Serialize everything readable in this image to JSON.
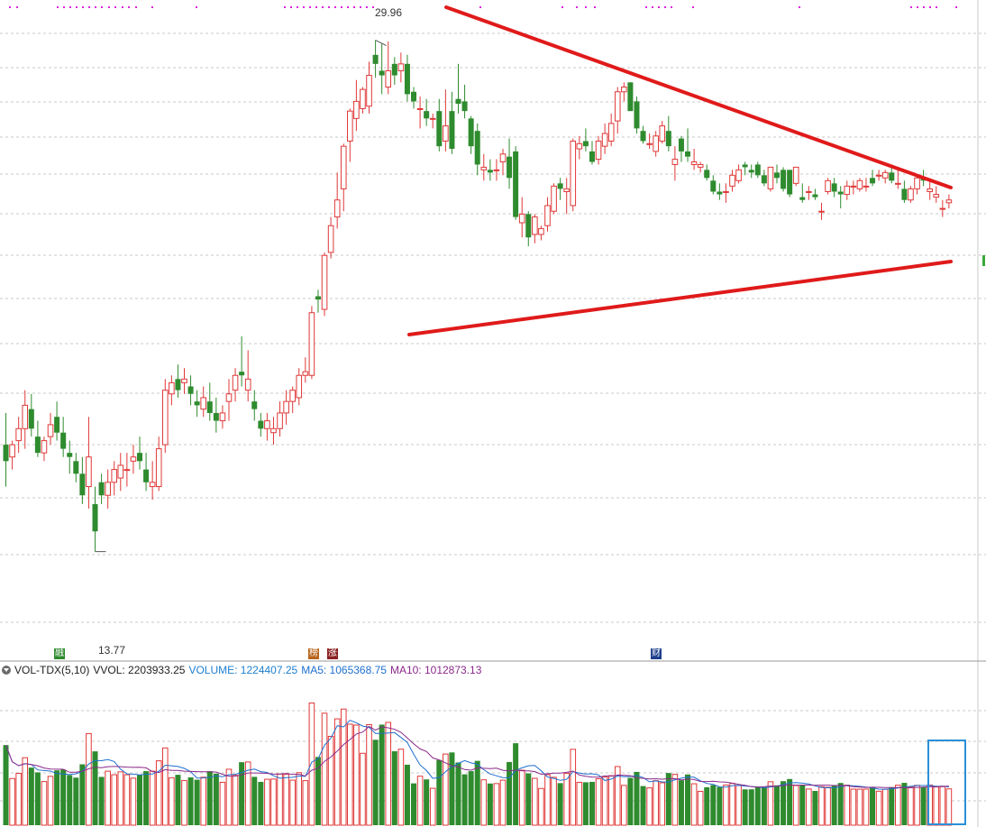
{
  "chart_data": {
    "type": "candlestick",
    "panels": [
      {
        "name": "price",
        "y_range": [
          12.0,
          31.5
        ],
        "y_scale": "log",
        "high_label": "29.96",
        "low_label": "13.77",
        "candles": [
          [
            16.2,
            17.0,
            15.2,
            15.8
          ],
          [
            15.9,
            16.3,
            15.6,
            16.2
          ],
          [
            16.3,
            16.9,
            16.0,
            16.6
          ],
          [
            16.6,
            17.6,
            16.1,
            17.2
          ],
          [
            17.1,
            17.5,
            16.4,
            16.6
          ],
          [
            16.4,
            16.8,
            15.9,
            16.0
          ],
          [
            16.0,
            16.4,
            15.8,
            16.3
          ],
          [
            16.4,
            17.0,
            16.2,
            16.7
          ],
          [
            16.9,
            17.3,
            16.3,
            16.5
          ],
          [
            16.5,
            16.9,
            15.9,
            16.1
          ],
          [
            16.0,
            16.3,
            15.5,
            15.9
          ],
          [
            15.8,
            16.0,
            15.3,
            15.5
          ],
          [
            15.5,
            15.9,
            14.8,
            15.0
          ],
          [
            15.2,
            16.9,
            14.7,
            15.9
          ],
          [
            14.8,
            15.2,
            13.77,
            14.2
          ],
          [
            15.3,
            15.5,
            14.8,
            15.0
          ],
          [
            15.0,
            15.6,
            14.7,
            15.3
          ],
          [
            15.3,
            15.8,
            15.0,
            15.6
          ],
          [
            15.4,
            16.0,
            15.1,
            15.7
          ],
          [
            15.6,
            16.0,
            15.2,
            15.6
          ],
          [
            15.8,
            16.2,
            15.5,
            15.9
          ],
          [
            16.0,
            16.4,
            15.6,
            15.8
          ],
          [
            15.6,
            16.0,
            15.1,
            15.3
          ],
          [
            15.2,
            15.8,
            14.9,
            15.3
          ],
          [
            15.2,
            16.4,
            15.1,
            16.1
          ],
          [
            16.2,
            17.9,
            16.0,
            17.6
          ],
          [
            17.5,
            18.0,
            17.2,
            17.8
          ],
          [
            17.9,
            18.3,
            17.4,
            17.6
          ],
          [
            17.8,
            18.2,
            17.5,
            17.9
          ],
          [
            17.7,
            18.0,
            17.2,
            17.5
          ],
          [
            17.3,
            17.6,
            16.9,
            17.2
          ],
          [
            17.1,
            17.7,
            16.9,
            17.4
          ],
          [
            17.3,
            17.8,
            16.8,
            17.0
          ],
          [
            17.0,
            17.4,
            16.5,
            16.8
          ],
          [
            16.8,
            17.2,
            16.6,
            17.0
          ],
          [
            17.3,
            17.9,
            16.8,
            17.5
          ],
          [
            17.6,
            18.2,
            17.3,
            18.0
          ],
          [
            18.1,
            19.1,
            17.7,
            18.0
          ],
          [
            17.6,
            18.7,
            17.3,
            17.9
          ],
          [
            17.3,
            17.6,
            16.8,
            17.1
          ],
          [
            16.8,
            17.0,
            16.4,
            16.6
          ],
          [
            16.6,
            17.0,
            16.3,
            16.8
          ],
          [
            16.5,
            16.9,
            16.2,
            16.6
          ],
          [
            16.6,
            17.3,
            16.4,
            17.0
          ],
          [
            17.0,
            17.6,
            16.7,
            17.3
          ],
          [
            17.3,
            17.7,
            17.0,
            17.6
          ],
          [
            17.4,
            18.2,
            17.2,
            18.0
          ],
          [
            18.0,
            18.5,
            17.8,
            18.1
          ],
          [
            18.0,
            20.0,
            17.9,
            19.8
          ],
          [
            20.3,
            20.5,
            19.8,
            20.2
          ],
          [
            19.9,
            21.7,
            19.7,
            21.6
          ],
          [
            21.7,
            22.9,
            21.5,
            22.6
          ],
          [
            22.9,
            24.5,
            22.5,
            23.5
          ],
          [
            23.9,
            25.6,
            23.1,
            25.5
          ],
          [
            25.7,
            27.0,
            24.9,
            26.9
          ],
          [
            26.6,
            28.2,
            26.1,
            27.3
          ],
          [
            27.0,
            27.9,
            26.8,
            27.8
          ],
          [
            27.1,
            29.0,
            26.8,
            28.4
          ],
          [
            29.3,
            29.96,
            28.3,
            28.9
          ],
          [
            28.6,
            29.8,
            27.6,
            28.4
          ],
          [
            27.9,
            29.9,
            27.6,
            28.6
          ],
          [
            28.9,
            29.2,
            28.0,
            28.4
          ],
          [
            28.6,
            29.4,
            28.1,
            28.9
          ],
          [
            28.9,
            29.3,
            27.3,
            27.6
          ],
          [
            27.7,
            27.9,
            27.0,
            27.3
          ],
          [
            27.0,
            27.5,
            26.2,
            27.0
          ],
          [
            26.9,
            27.4,
            26.3,
            26.6
          ],
          [
            26.6,
            26.8,
            26.2,
            26.6
          ],
          [
            26.9,
            27.4,
            25.3,
            25.5
          ],
          [
            25.7,
            27.8,
            25.3,
            26.3
          ],
          [
            26.9,
            27.7,
            25.2,
            25.4
          ],
          [
            27.4,
            28.9,
            26.8,
            27.2
          ],
          [
            27.3,
            28.0,
            26.6,
            26.9
          ],
          [
            26.6,
            26.7,
            25.2,
            25.5
          ],
          [
            26.1,
            26.4,
            24.4,
            24.8
          ],
          [
            24.6,
            25.2,
            24.2,
            24.7
          ],
          [
            24.6,
            25.0,
            24.2,
            24.5
          ],
          [
            24.6,
            25.0,
            24.2,
            24.6
          ],
          [
            24.9,
            25.4,
            24.4,
            25.2
          ],
          [
            25.1,
            25.8,
            23.9,
            24.3
          ],
          [
            25.3,
            25.5,
            22.8,
            22.9
          ],
          [
            22.7,
            23.6,
            22.2,
            23.0
          ],
          [
            23.0,
            23.1,
            21.9,
            22.2
          ],
          [
            22.3,
            23.0,
            22.0,
            22.9
          ],
          [
            22.3,
            22.6,
            22.1,
            22.5
          ],
          [
            22.6,
            23.6,
            22.4,
            23.3
          ],
          [
            23.1,
            24.1,
            23.0,
            24.0
          ],
          [
            24.1,
            24.3,
            23.5,
            23.9
          ],
          [
            23.8,
            24.3,
            23.0,
            23.9
          ],
          [
            23.3,
            25.8,
            23.1,
            25.7
          ],
          [
            25.4,
            25.9,
            25.0,
            25.6
          ],
          [
            25.7,
            26.2,
            25.3,
            25.5
          ],
          [
            25.3,
            25.7,
            24.8,
            24.9
          ],
          [
            25.0,
            25.9,
            24.8,
            25.7
          ],
          [
            25.5,
            26.4,
            25.2,
            26.0
          ],
          [
            25.7,
            26.8,
            25.5,
            26.4
          ],
          [
            26.5,
            27.9,
            26.0,
            27.7
          ],
          [
            27.7,
            28.1,
            27.3,
            27.9
          ],
          [
            28.1,
            28.1,
            26.9,
            26.9
          ],
          [
            27.3,
            27.5,
            26.0,
            26.2
          ],
          [
            26.1,
            26.3,
            25.6,
            25.7
          ],
          [
            25.6,
            26.0,
            25.4,
            25.6
          ],
          [
            25.3,
            26.1,
            25.1,
            25.9
          ],
          [
            25.7,
            26.5,
            25.6,
            26.3
          ],
          [
            26.1,
            26.7,
            25.3,
            25.5
          ],
          [
            24.8,
            25.5,
            24.2,
            25.0
          ],
          [
            25.8,
            25.9,
            24.9,
            25.3
          ],
          [
            25.3,
            26.2,
            24.9,
            25.1
          ],
          [
            24.8,
            25.4,
            24.6,
            24.9
          ],
          [
            24.7,
            24.9,
            24.5,
            24.8
          ],
          [
            24.6,
            24.8,
            24.2,
            24.3
          ],
          [
            24.2,
            24.4,
            23.7,
            23.8
          ],
          [
            23.8,
            24.1,
            23.5,
            23.7
          ],
          [
            23.8,
            24.1,
            23.4,
            23.8
          ],
          [
            24.0,
            24.6,
            23.8,
            24.4
          ],
          [
            24.2,
            24.8,
            24.1,
            24.6
          ],
          [
            24.8,
            24.9,
            24.4,
            24.7
          ],
          [
            24.6,
            24.8,
            24.3,
            24.5
          ],
          [
            24.8,
            24.9,
            24.3,
            24.4
          ],
          [
            24.4,
            24.6,
            24.0,
            24.1
          ],
          [
            23.9,
            24.7,
            23.8,
            24.7
          ],
          [
            24.5,
            24.8,
            24.1,
            24.3
          ],
          [
            24.6,
            24.7,
            23.8,
            23.9
          ],
          [
            24.6,
            24.6,
            23.6,
            23.7
          ],
          [
            24.1,
            24.7,
            24.0,
            24.7
          ],
          [
            23.6,
            24.1,
            23.4,
            23.5
          ],
          [
            23.8,
            24.0,
            23.5,
            23.8
          ],
          [
            23.7,
            23.9,
            23.5,
            23.6
          ],
          [
            23.1,
            23.4,
            22.8,
            23.1
          ],
          [
            23.8,
            24.3,
            23.7,
            24.2
          ],
          [
            24.1,
            24.3,
            23.6,
            23.8
          ],
          [
            23.8,
            24.0,
            23.2,
            23.7
          ],
          [
            23.7,
            24.2,
            23.5,
            24.0
          ],
          [
            24.0,
            24.2,
            23.7,
            24.0
          ],
          [
            23.9,
            24.3,
            23.8,
            24.2
          ],
          [
            24.0,
            24.3,
            23.8,
            24.0
          ],
          [
            24.3,
            24.6,
            24.0,
            24.1
          ],
          [
            24.4,
            24.6,
            24.2,
            24.4
          ],
          [
            24.3,
            24.6,
            24.1,
            24.5
          ],
          [
            24.5,
            24.7,
            24.1,
            24.2
          ],
          [
            24.1,
            24.6,
            23.9,
            24.1
          ],
          [
            23.9,
            24.2,
            23.4,
            23.5
          ],
          [
            23.5,
            24.0,
            23.4,
            23.9
          ],
          [
            23.9,
            24.4,
            23.7,
            24.3
          ],
          [
            24.3,
            24.6,
            24.0,
            24.2
          ],
          [
            23.8,
            24.2,
            23.5,
            23.9
          ],
          [
            23.6,
            24.0,
            23.4,
            23.7
          ],
          [
            23.2,
            23.5,
            22.9,
            23.2
          ],
          [
            23.4,
            23.7,
            23.2,
            23.5
          ]
        ],
        "trendlines": [
          {
            "from": [
              0.454,
              0.4745
            ],
            "to": [
              0.963,
              0.2745
            ]
          },
          {
            "from": [
              0.454,
              0.4745
            ],
            "to": [
              0.963,
              0.2745
            ]
          }
        ]
      }
    ],
    "volume": {
      "header": {
        "name": "VOL-TDX(5,10)",
        "vvol": "VVOL: 2203933.25",
        "volume": "VOLUME: 1224407.25",
        "ma5": "MA5: 1065368.75",
        "ma10": "MA10: 1012873.13"
      },
      "y_max": 2800000
    },
    "markers": {
      "top_dots_color": "#dd22dd",
      "tags": [
        {
          "label": "融",
          "color": "#2e8b2e"
        },
        {
          "label": "榜",
          "color": "#b8651c"
        },
        {
          "label": "涨",
          "color": "#8b2020"
        },
        {
          "label": "财",
          "color": "#1c3d8b"
        }
      ]
    },
    "colors": {
      "up": "#e03838",
      "down": "#2e8b2e",
      "trendline": "#e01a1a",
      "ma5": "#1e6fcf",
      "ma10": "#8a2a8a",
      "highlight_box": "#2a8fd8"
    }
  }
}
